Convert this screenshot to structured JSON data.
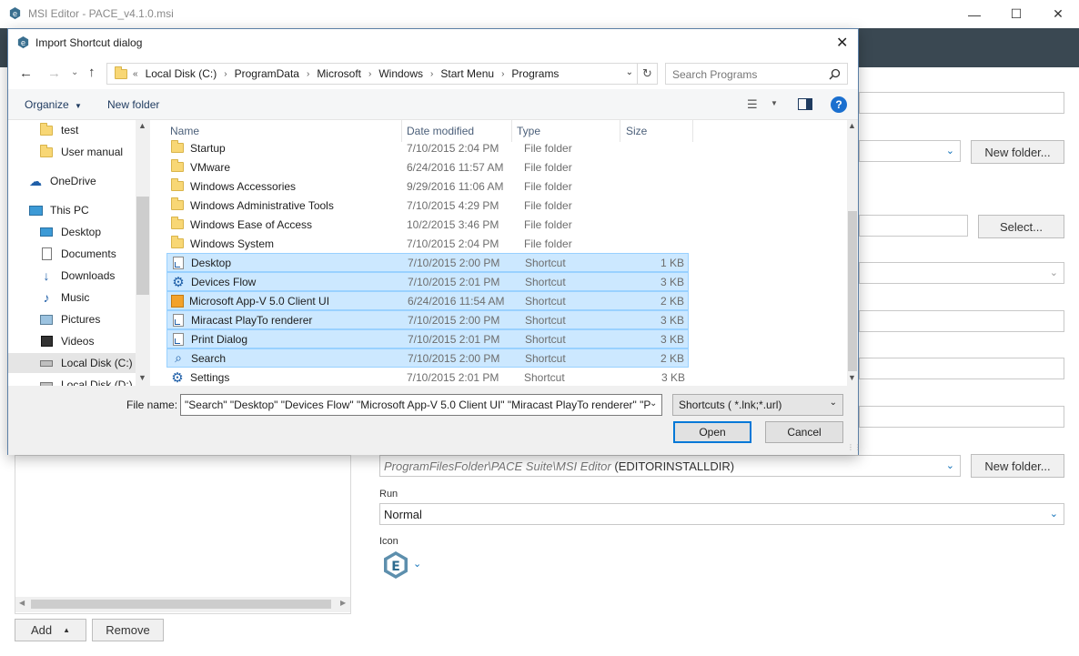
{
  "main_window": {
    "title": "MSI Editor - PACE_v4.1.0.msi",
    "controls": {
      "minimize": "—",
      "maximize": "☐",
      "close": "✕"
    },
    "new_folder_label": "New folder...",
    "select_label": "Select...",
    "install_dir_path": "ProgramFilesFolder\\PACE Suite\\MSI Editor",
    "install_dir_property": "(EDITORINSTALLDIR)",
    "run_label": "Run",
    "run_value": "Normal",
    "icon_label": "Icon",
    "add_label": "Add",
    "remove_label": "Remove"
  },
  "dialog": {
    "title": "Import Shortcut dialog",
    "close_glyph": "✕",
    "breadcrumb": [
      "Local Disk (C:)",
      "ProgramData",
      "Microsoft",
      "Windows",
      "Start Menu",
      "Programs"
    ],
    "breadcrumb_prefix": "«",
    "search_placeholder": "Search Programs",
    "toolbar": {
      "organize": "Organize",
      "new_folder": "New folder"
    },
    "nav_items": [
      {
        "label": "test",
        "icon": "folder-icon"
      },
      {
        "label": "User manual",
        "icon": "folder-icon"
      },
      {
        "label": "OneDrive",
        "icon": "cloud-icon"
      },
      {
        "label": "This PC",
        "icon": "computer-icon"
      },
      {
        "label": "Desktop",
        "icon": "desktop-icon"
      },
      {
        "label": "Documents",
        "icon": "documents-icon"
      },
      {
        "label": "Downloads",
        "icon": "downloads-icon"
      },
      {
        "label": "Music",
        "icon": "music-icon"
      },
      {
        "label": "Pictures",
        "icon": "pictures-icon"
      },
      {
        "label": "Videos",
        "icon": "videos-icon"
      },
      {
        "label": "Local Disk (C:)",
        "icon": "drive-icon"
      },
      {
        "label": "Local Disk (D:)",
        "icon": "drive-icon"
      }
    ],
    "columns": {
      "name": "Name",
      "date": "Date modified",
      "type": "Type",
      "size": "Size"
    },
    "files": [
      {
        "name": "Startup",
        "date": "7/10/2015 2:04 PM",
        "type": "File folder",
        "size": "",
        "icon": "folder-icon",
        "selected": false
      },
      {
        "name": "VMware",
        "date": "6/24/2016 11:57 AM",
        "type": "File folder",
        "size": "",
        "icon": "folder-icon",
        "selected": false
      },
      {
        "name": "Windows Accessories",
        "date": "9/29/2016 11:06 AM",
        "type": "File folder",
        "size": "",
        "icon": "folder-icon",
        "selected": false
      },
      {
        "name": "Windows Administrative Tools",
        "date": "7/10/2015 4:29 PM",
        "type": "File folder",
        "size": "",
        "icon": "folder-icon",
        "selected": false
      },
      {
        "name": "Windows Ease of Access",
        "date": "10/2/2015 3:46 PM",
        "type": "File folder",
        "size": "",
        "icon": "folder-icon",
        "selected": false
      },
      {
        "name": "Windows System",
        "date": "7/10/2015 2:04 PM",
        "type": "File folder",
        "size": "",
        "icon": "folder-icon",
        "selected": false
      },
      {
        "name": "Desktop",
        "date": "7/10/2015 2:00 PM",
        "type": "Shortcut",
        "size": "1 KB",
        "icon": "shortcut-icon",
        "selected": true
      },
      {
        "name": "Devices Flow",
        "date": "7/10/2015 2:01 PM",
        "type": "Shortcut",
        "size": "3 KB",
        "icon": "gear-icon",
        "selected": true
      },
      {
        "name": "Microsoft App-V 5.0 Client UI",
        "date": "6/24/2016 11:54 AM",
        "type": "Shortcut",
        "size": "2 KB",
        "icon": "appv-icon",
        "selected": true
      },
      {
        "name": "Miracast PlayTo renderer",
        "date": "7/10/2015 2:00 PM",
        "type": "Shortcut",
        "size": "3 KB",
        "icon": "shortcut-icon",
        "selected": true
      },
      {
        "name": "Print Dialog",
        "date": "7/10/2015 2:01 PM",
        "type": "Shortcut",
        "size": "3 KB",
        "icon": "shortcut-icon",
        "selected": true
      },
      {
        "name": "Search",
        "date": "7/10/2015 2:00 PM",
        "type": "Shortcut",
        "size": "2 KB",
        "icon": "search-icon",
        "selected": true
      },
      {
        "name": "Settings",
        "date": "7/10/2015 2:01 PM",
        "type": "Shortcut",
        "size": "3 KB",
        "icon": "gear-icon",
        "selected": false
      }
    ],
    "file_name_label": "File name:",
    "file_name_value": "\"Search\" \"Desktop\" \"Devices Flow\" \"Microsoft App-V 5.0 Client UI\" \"Miracast PlayTo renderer\" \"P",
    "filter_value": "Shortcuts ( *.lnk;*.url)",
    "open_label": "Open",
    "cancel_label": "Cancel"
  },
  "colors": {
    "header_bar": "#3a4852",
    "selection": "#cce8ff",
    "accent": "#0d6fb8"
  }
}
